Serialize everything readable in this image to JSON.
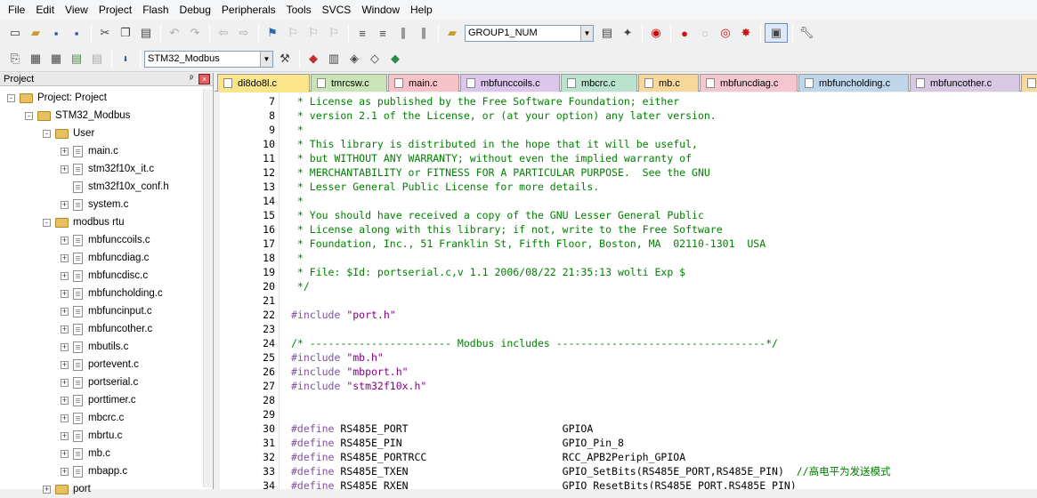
{
  "menu": [
    "File",
    "Edit",
    "View",
    "Project",
    "Flash",
    "Debug",
    "Peripherals",
    "Tools",
    "SVCS",
    "Window",
    "Help"
  ],
  "toolbar1": {
    "combo_value": "GROUP1_NUM"
  },
  "toolbar2": {
    "target_value": "STM32_Modbus"
  },
  "panel": {
    "title": "Project",
    "pin": "ᵖ",
    "close": "×"
  },
  "tree": {
    "root": "Project: Project",
    "target": "STM32_Modbus",
    "group_user": "User",
    "user_files": [
      "main.c",
      "stm32f10x_it.c",
      "stm32f10x_conf.h",
      "system.c"
    ],
    "group_modbus": "modbus rtu",
    "modbus_files": [
      "mbfunccoils.c",
      "mbfuncdiag.c",
      "mbfuncdisc.c",
      "mbfuncholding.c",
      "mbfuncinput.c",
      "mbfuncother.c",
      "mbutils.c",
      "portevent.c",
      "portserial.c",
      "porttimer.c",
      "mbcrc.c",
      "mbrtu.c",
      "mb.c",
      "mbapp.c"
    ],
    "group_port": "port"
  },
  "tabs": [
    {
      "label": "di8do8l.c",
      "color": "#fbe58a"
    },
    {
      "label": "tmrcsw.c",
      "color": "#c9e5b8"
    },
    {
      "label": "main.c",
      "color": "#f7c2c8"
    },
    {
      "label": "mbfunccoils.c",
      "color": "#dcc6ec"
    },
    {
      "label": "mbcrc.c",
      "color": "#b9e2cf"
    },
    {
      "label": "mb.c",
      "color": "#f8d89a"
    },
    {
      "label": "mbfuncdiag.c",
      "color": "#f5c5d0"
    },
    {
      "label": "mbfuncholding.c",
      "color": "#bfd6ea"
    },
    {
      "label": "mbfuncother.c",
      "color": "#d8c8e4"
    },
    {
      "label": "",
      "color": "#f8d89a"
    }
  ],
  "code_lines": [
    {
      "n": "7",
      "parts": [
        {
          "t": " * License as published by the Free Software Foundation; either",
          "c": "cm"
        }
      ]
    },
    {
      "n": "8",
      "parts": [
        {
          "t": " * version 2.1 of the License, or (at your option) any later version.",
          "c": "cm"
        }
      ]
    },
    {
      "n": "9",
      "parts": [
        {
          "t": " *",
          "c": "cm"
        }
      ]
    },
    {
      "n": "10",
      "parts": [
        {
          "t": " * This library is distributed in the hope that it will be useful,",
          "c": "cm"
        }
      ]
    },
    {
      "n": "11",
      "parts": [
        {
          "t": " * but WITHOUT ANY WARRANTY; without even the implied warranty of",
          "c": "cm"
        }
      ]
    },
    {
      "n": "12",
      "parts": [
        {
          "t": " * MERCHANTABILITY or FITNESS FOR A PARTICULAR PURPOSE.  See the GNU",
          "c": "cm"
        }
      ]
    },
    {
      "n": "13",
      "parts": [
        {
          "t": " * Lesser General Public License for more details.",
          "c": "cm"
        }
      ]
    },
    {
      "n": "14",
      "parts": [
        {
          "t": " *",
          "c": "cm"
        }
      ]
    },
    {
      "n": "15",
      "parts": [
        {
          "t": " * You should have received a copy of the GNU Lesser General Public",
          "c": "cm"
        }
      ]
    },
    {
      "n": "16",
      "parts": [
        {
          "t": " * License along with this library; if not, write to the Free Software",
          "c": "cm"
        }
      ]
    },
    {
      "n": "17",
      "parts": [
        {
          "t": " * Foundation, Inc., 51 Franklin St, Fifth Floor, Boston, MA  02110-1301  USA",
          "c": "cm"
        }
      ]
    },
    {
      "n": "18",
      "parts": [
        {
          "t": " *",
          "c": "cm"
        }
      ]
    },
    {
      "n": "19",
      "parts": [
        {
          "t": " * File: $Id: portserial.c,v 1.1 2006/08/22 21:35:13 wolti Exp $",
          "c": "cm"
        }
      ]
    },
    {
      "n": "20",
      "parts": [
        {
          "t": " */",
          "c": "cm"
        }
      ]
    },
    {
      "n": "21",
      "parts": []
    },
    {
      "n": "22",
      "parts": [
        {
          "t": "#include ",
          "c": "kw"
        },
        {
          "t": "\"port.h\"",
          "c": "st"
        }
      ]
    },
    {
      "n": "23",
      "parts": []
    },
    {
      "n": "24",
      "parts": [
        {
          "t": "/* ----------------------- Modbus includes ----------------------------------*/",
          "c": "cm"
        }
      ]
    },
    {
      "n": "25",
      "parts": [
        {
          "t": "#include ",
          "c": "kw"
        },
        {
          "t": "\"mb.h\"",
          "c": "st"
        }
      ]
    },
    {
      "n": "26",
      "parts": [
        {
          "t": "#include ",
          "c": "kw"
        },
        {
          "t": "\"mbport.h\"",
          "c": "st"
        }
      ]
    },
    {
      "n": "27",
      "parts": [
        {
          "t": "#include ",
          "c": "kw"
        },
        {
          "t": "\"stm32f10x.h\"",
          "c": "st"
        }
      ]
    },
    {
      "n": "28",
      "parts": []
    },
    {
      "n": "29",
      "parts": []
    },
    {
      "n": "30",
      "parts": [
        {
          "t": "#define ",
          "c": "kw"
        },
        {
          "t": "RS485E_PORT                         GPIOA",
          "c": "tx"
        }
      ]
    },
    {
      "n": "31",
      "parts": [
        {
          "t": "#define ",
          "c": "kw"
        },
        {
          "t": "RS485E_PIN                          GPIO_Pin_8",
          "c": "tx"
        }
      ]
    },
    {
      "n": "32",
      "parts": [
        {
          "t": "#define ",
          "c": "kw"
        },
        {
          "t": "RS485E_PORTRCC                      RCC_APB2Periph_GPIOA",
          "c": "tx"
        }
      ]
    },
    {
      "n": "33",
      "parts": [
        {
          "t": "#define ",
          "c": "kw"
        },
        {
          "t": "RS485E_TXEN                         GPIO_SetBits(RS485E_PORT,RS485E_PIN)  ",
          "c": "tx"
        },
        {
          "t": "//高电平为发送模式",
          "c": "cm"
        }
      ]
    },
    {
      "n": "34",
      "parts": [
        {
          "t": "#define ",
          "c": "kw"
        },
        {
          "t": "RS485E_RXEN                         GPIO_ResetBits(RS485E_PORT,RS485E_PIN)",
          "c": "tx"
        }
      ]
    }
  ]
}
